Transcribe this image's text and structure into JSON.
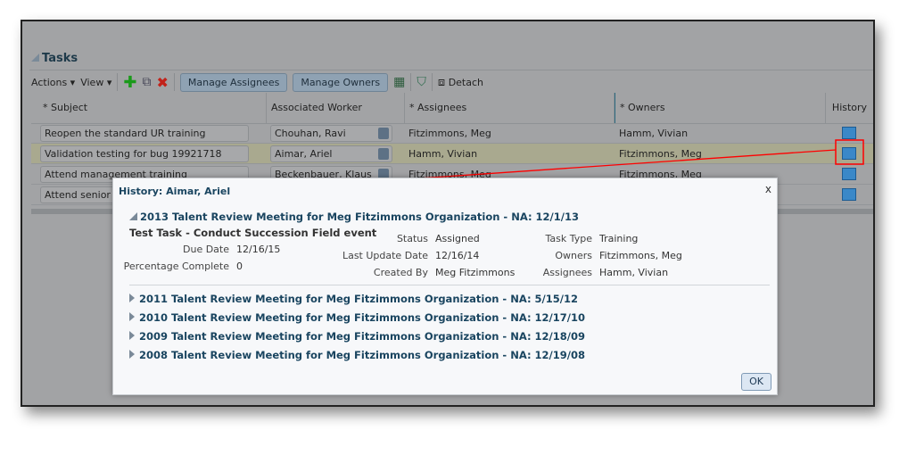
{
  "panel": {
    "title": "Tasks"
  },
  "toolbar": {
    "actions": "Actions",
    "view": "View",
    "manage_assignees": "Manage Assignees",
    "manage_owners": "Manage Owners",
    "detach": "Detach"
  },
  "table": {
    "columns": [
      "* Subject",
      "Associated Worker",
      "* Assignees",
      "* Owners",
      "History"
    ],
    "rows": [
      {
        "subject": "Reopen the standard UR training",
        "worker": "Chouhan, Ravi",
        "assignees": "Fitzimmons, Meg",
        "owners": "Hamm, Vivian"
      },
      {
        "subject": "Validation testing for bug 19921718",
        "worker": "Aimar, Ariel",
        "assignees": "Hamm, Vivian",
        "owners": "Fitzimmons, Meg"
      },
      {
        "subject": "Attend management training",
        "worker": "Beckenbauer, Klaus",
        "assignees": "Fitzimmons, Meg",
        "owners": "Fitzimmons, Meg"
      },
      {
        "subject": "Attend senior m",
        "worker": "",
        "assignees": "",
        "owners": ""
      }
    ]
  },
  "dialog": {
    "title": "History: Aimar, Ariel",
    "close": "x",
    "expanded": {
      "title": "2013 Talent Review Meeting for Meg Fitzimmons Organization - NA: 12/1/13",
      "task": "Test Task - Conduct Succession Field event",
      "fields": {
        "due_date_label": "Due Date",
        "due_date": "12/16/15",
        "pct_label": "Percentage Complete",
        "pct": "0",
        "status_label": "Status",
        "status": "Assigned",
        "last_update_label": "Last Update Date",
        "last_update": "12/16/14",
        "created_by_label": "Created By",
        "created_by": "Meg Fitzimmons",
        "task_type_label": "Task Type",
        "task_type": "Training",
        "owners_label": "Owners",
        "owners": "Fitzimmons, Meg",
        "assignees_label": "Assignees",
        "assignees": "Hamm, Vivian"
      }
    },
    "collapsed": [
      "2011 Talent Review Meeting for Meg Fitzimmons Organization - NA: 5/15/12",
      "2010 Talent Review Meeting for Meg Fitzimmons Organization - NA: 12/17/10",
      "2009 Talent Review Meeting for Meg Fitzimmons Organization - NA: 12/18/09",
      "2008 Talent Review Meeting for Meg Fitzimmons Organization - NA: 12/19/08"
    ],
    "ok": "OK"
  },
  "colors": {
    "annotation": "#ff0000",
    "link": "#1a4560"
  }
}
